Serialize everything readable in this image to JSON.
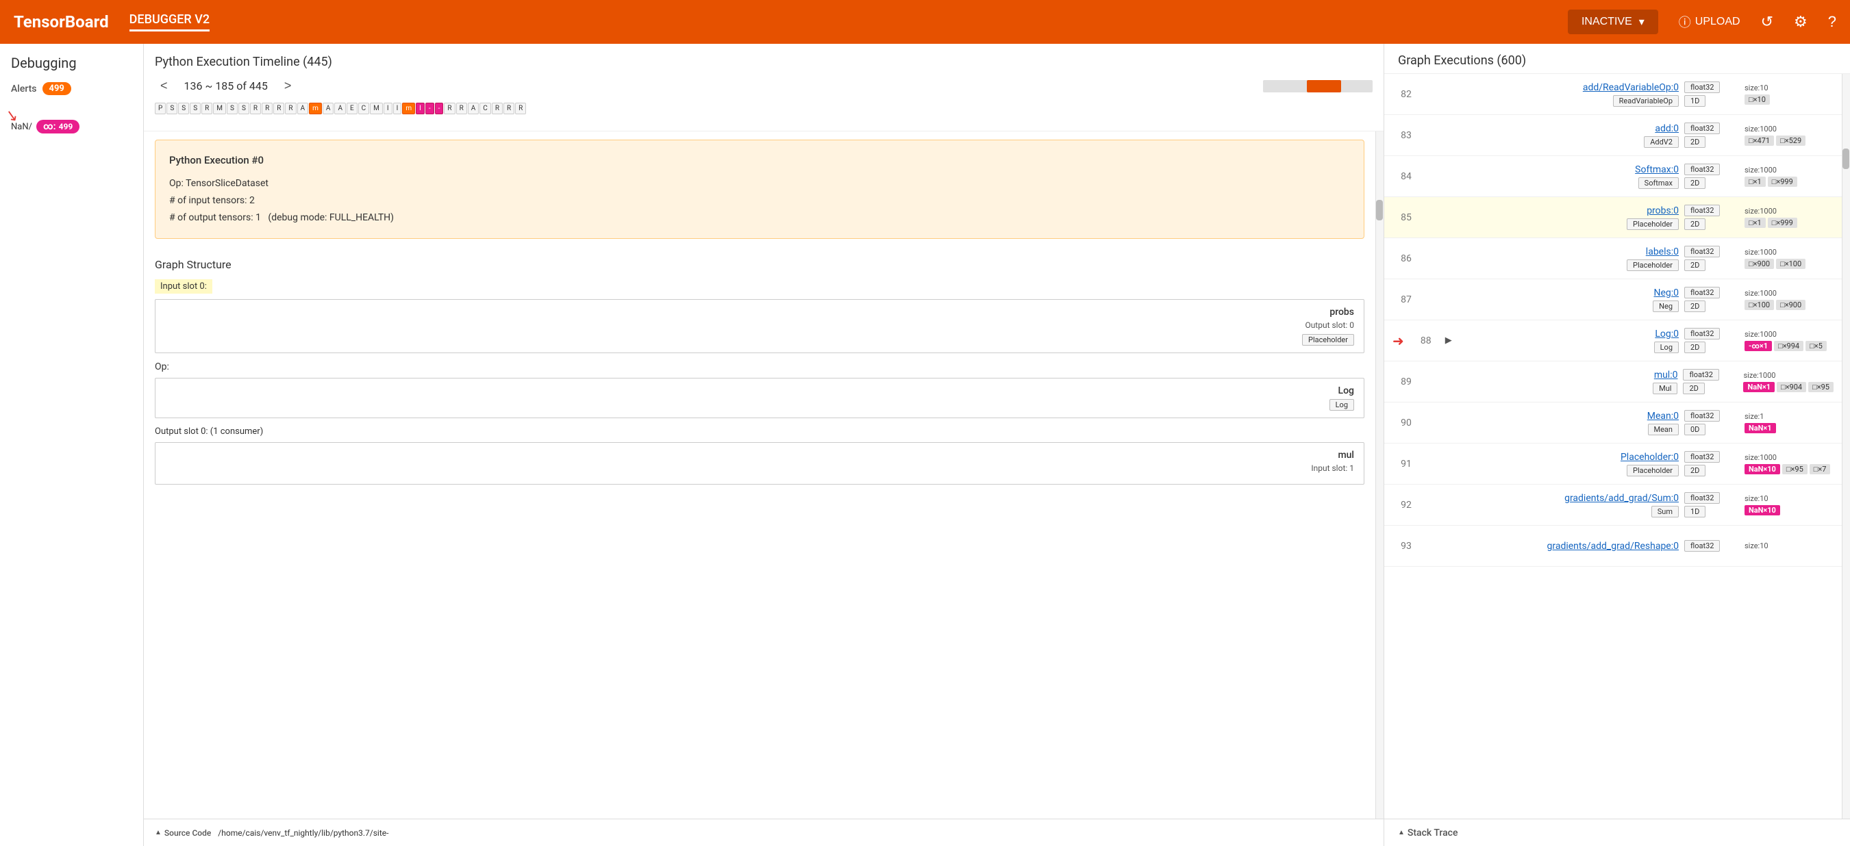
{
  "app": {
    "brand": "TensorBoard",
    "nav_label": "DEBUGGER V2",
    "status": "INACTIVE",
    "upload_label": "UPLOAD"
  },
  "sidebar": {
    "title": "Debugging",
    "alerts_label": "Alerts",
    "alerts_count": "499",
    "nan_label": "NaN/",
    "nan_badge": "∞: 499"
  },
  "python_timeline": {
    "title": "Python Execution Timeline (445)",
    "range_text": "136 ~ 185 of 445",
    "items": [
      {
        "label": "P",
        "type": "normal"
      },
      {
        "label": "S",
        "type": "normal"
      },
      {
        "label": "S",
        "type": "normal"
      },
      {
        "label": "S",
        "type": "normal"
      },
      {
        "label": "R",
        "type": "normal"
      },
      {
        "label": "M",
        "type": "normal"
      },
      {
        "label": "S",
        "type": "normal"
      },
      {
        "label": "S",
        "type": "normal"
      },
      {
        "label": "R",
        "type": "normal"
      },
      {
        "label": "R",
        "type": "normal"
      },
      {
        "label": "R",
        "type": "normal"
      },
      {
        "label": "R",
        "type": "normal"
      },
      {
        "label": "A",
        "type": "normal"
      },
      {
        "label": "m",
        "type": "highlight"
      },
      {
        "label": "A",
        "type": "normal"
      },
      {
        "label": "A",
        "type": "normal"
      },
      {
        "label": "E",
        "type": "normal"
      },
      {
        "label": "C",
        "type": "normal"
      },
      {
        "label": "M",
        "type": "normal"
      },
      {
        "label": "I",
        "type": "normal"
      },
      {
        "label": "I",
        "type": "normal"
      },
      {
        "label": "m",
        "type": "highlight"
      },
      {
        "label": "I",
        "type": "highlight2"
      },
      {
        "label": "-",
        "type": "highlight2"
      },
      {
        "label": "-",
        "type": "highlight2"
      },
      {
        "label": "R",
        "type": "normal"
      },
      {
        "label": "R",
        "type": "normal"
      },
      {
        "label": "A",
        "type": "normal"
      },
      {
        "label": "C",
        "type": "normal"
      },
      {
        "label": "R",
        "type": "normal"
      },
      {
        "label": "R",
        "type": "normal"
      },
      {
        "label": "R",
        "type": "normal"
      }
    ],
    "execution_detail": {
      "title": "Python Execution #0",
      "op": "TensorSliceDataset",
      "input_tensors": "2",
      "output_tensors": "1",
      "debug_mode": "FULL_HEALTH"
    }
  },
  "graph_structure": {
    "title": "Graph Structure",
    "input_slot_label": "Input slot 0:",
    "input_card": {
      "name": "probs",
      "sub": "Output slot: 0",
      "tag": "Placeholder"
    },
    "op_label": "Op:",
    "op_card": {
      "name": "Log",
      "tag": "Log"
    },
    "output_slot_label": "Output slot 0: (1 consumer)",
    "output_card": {
      "name": "mul",
      "sub": "Input slot: 1"
    }
  },
  "source_code": {
    "label": "Source Code",
    "path": "/home/cais/venv_tf_nightly/lib/python3.7/site-"
  },
  "graph_executions": {
    "title": "Graph Executions (600)",
    "rows": [
      {
        "num": "82",
        "play": "",
        "op_name": "add/ReadVariableOp:0",
        "op_tag": "ReadVariableOp",
        "dtype": "float32",
        "dim": "1D",
        "size_label": "size:10",
        "tensor_tags": [
          "□×10"
        ]
      },
      {
        "num": "83",
        "play": "",
        "op_name": "add:0",
        "op_tag": "AddV2",
        "dtype": "float32",
        "dim": "2D",
        "size_label": "size:1000",
        "tensor_tags": [
          "□×471",
          "□×529"
        ]
      },
      {
        "num": "84",
        "play": "",
        "op_name": "Softmax:0",
        "op_tag": "Softmax",
        "dtype": "float32",
        "dim": "2D",
        "size_label": "size:1000",
        "tensor_tags": [
          "□×1",
          "□×999"
        ]
      },
      {
        "num": "85",
        "play": "",
        "highlighted": true,
        "op_name": "probs:0",
        "op_tag": "Placeholder",
        "dtype": "float32",
        "dim": "2D",
        "size_label": "size:1000",
        "tensor_tags": [
          "□×1",
          "□×999"
        ]
      },
      {
        "num": "86",
        "play": "",
        "op_name": "labels:0",
        "op_tag": "Placeholder",
        "dtype": "float32",
        "dim": "2D",
        "size_label": "size:1000",
        "tensor_tags": [
          "□×900",
          "□×100"
        ]
      },
      {
        "num": "87",
        "play": "",
        "op_name": "Neg:0",
        "op_tag": "Neg",
        "dtype": "float32",
        "dim": "2D",
        "size_label": "size:1000",
        "tensor_tags": [
          "□×100",
          "□×900"
        ]
      },
      {
        "num": "88",
        "play": "▶",
        "arrow": true,
        "op_name": "Log:0",
        "op_tag": "Log",
        "dtype": "float32",
        "dim": "2D",
        "size_label": "size:1000",
        "tensor_tags": [
          "-∞×1",
          "□×994",
          "□×5"
        ],
        "nan_tags": [
          "-∞×1"
        ]
      },
      {
        "num": "89",
        "play": "",
        "op_name": "mul:0",
        "op_tag": "Mul",
        "dtype": "float32",
        "dim": "2D",
        "size_label": "size:1000",
        "tensor_tags": [
          "NaN×1",
          "□×904",
          "□×95"
        ],
        "nan_tags": [
          "NaN×1"
        ]
      },
      {
        "num": "90",
        "play": "",
        "op_name": "Mean:0",
        "op_tag": "Mean",
        "dtype": "float32",
        "dim": "0D",
        "size_label": "size:1",
        "tensor_tags": [
          "NaN×1"
        ],
        "nan_tags": [
          "NaN×1"
        ]
      },
      {
        "num": "91",
        "play": "",
        "op_name": "Placeholder:0",
        "op_tag": "Placeholder",
        "dtype": "float32",
        "dim": "2D",
        "size_label": "size:1000",
        "tensor_tags": [
          "NaN×10",
          "□×95",
          "□×7"
        ],
        "nan_tags": [
          "NaN×10"
        ]
      },
      {
        "num": "92",
        "play": "",
        "op_name": "gradients/add_grad/Sum:0",
        "op_tag": "Sum",
        "dtype": "float32",
        "dim": "1D",
        "size_label": "size:10",
        "tensor_tags": [
          "NaN×10"
        ],
        "nan_tags": [
          "NaN×10"
        ]
      },
      {
        "num": "93",
        "play": "",
        "op_name": "gradients/add_grad/Reshape:0",
        "op_tag": "",
        "dtype": "float32",
        "dim": "",
        "size_label": "size:10",
        "tensor_tags": []
      }
    ]
  },
  "stack_trace": {
    "label": "Stack Trace"
  },
  "icons": {
    "chevron_down": "▾",
    "info_circle": "ⓘ",
    "refresh": "↺",
    "settings": "⚙",
    "help": "?",
    "prev": "<",
    "next": ">",
    "play": "▶",
    "arrow_down_right": "↘"
  }
}
